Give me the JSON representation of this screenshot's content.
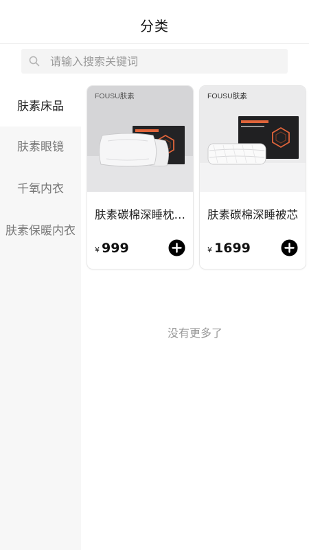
{
  "header": {
    "title": "分类"
  },
  "search": {
    "placeholder": "请输入搜索关键词",
    "icon": "search-icon"
  },
  "sidebar": {
    "items": [
      {
        "label": "肤素床品",
        "active": true
      },
      {
        "label": "肤素眼镜",
        "active": false
      },
      {
        "label": "千氧内衣",
        "active": false
      },
      {
        "label": "肤素保暖内衣",
        "active": false
      }
    ]
  },
  "products": [
    {
      "brand": "FOUSU肤素",
      "name": "肤素碳棉深睡枕套装",
      "currency": "¥",
      "price": "999"
    },
    {
      "brand": "FOUSU肤素",
      "name": "肤素碳棉深睡被芯",
      "currency": "¥",
      "price": "1699"
    }
  ],
  "footer": {
    "no_more": "没有更多了"
  },
  "colors": {
    "accent": "#000000",
    "sidebar_bg": "#f7f7f7",
    "search_bg": "#f4f4f4",
    "product_bg_1": "#d6d6d8",
    "product_bg_2": "#ececec",
    "box_accent": "#e0643a"
  }
}
